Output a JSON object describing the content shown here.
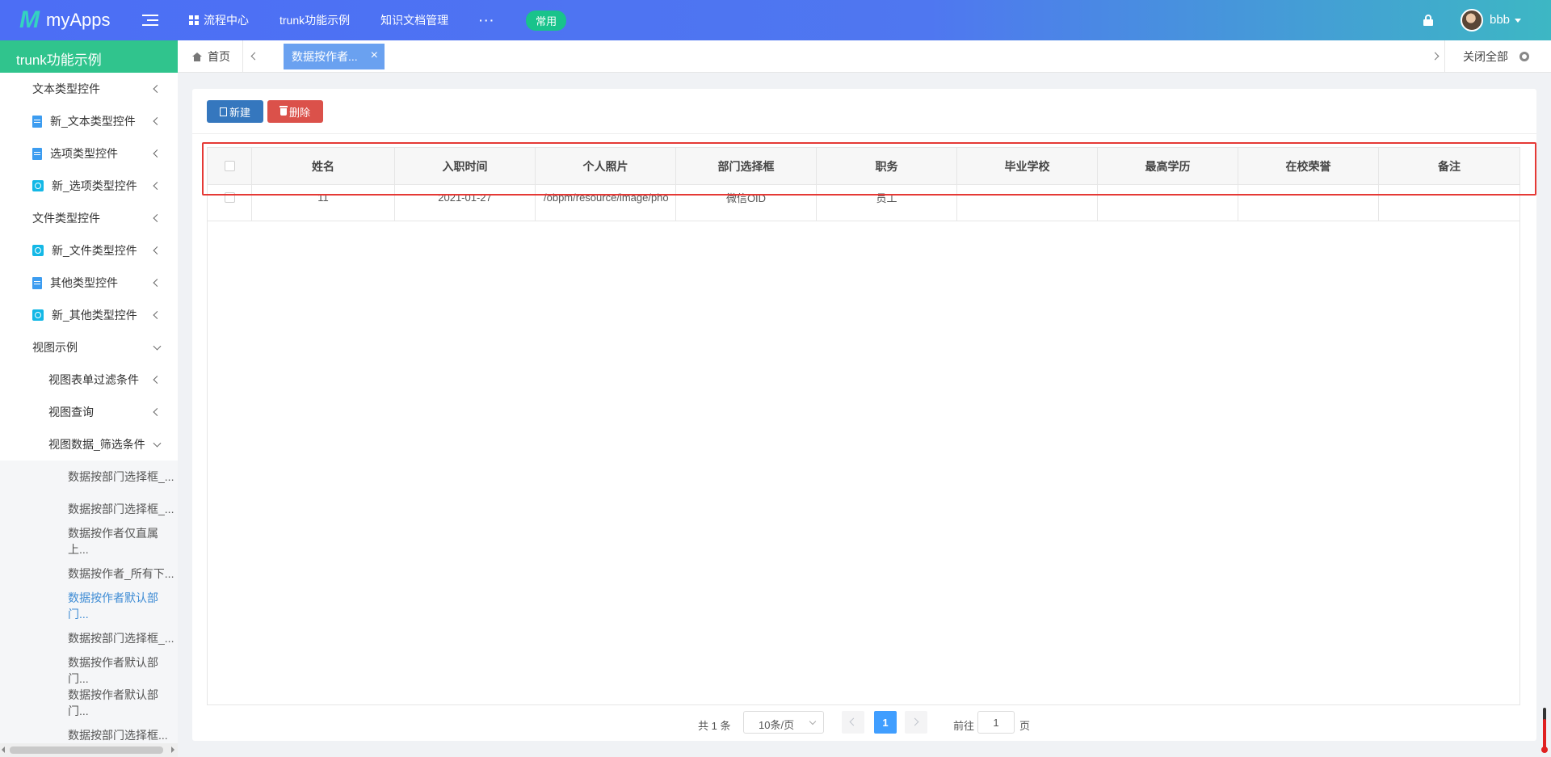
{
  "header": {
    "app_name": "myApps",
    "nav": [
      {
        "label": "流程中心"
      },
      {
        "label": "trunk功能示例"
      },
      {
        "label": "知识文档管理"
      },
      {
        "label": "···"
      }
    ],
    "pill_label": "常用",
    "username": "bbb"
  },
  "sidebar": {
    "title": "trunk功能示例",
    "items": [
      {
        "label": "文本类型控件",
        "icon": "none",
        "chevron": "left"
      },
      {
        "label": "新_文本类型控件",
        "icon": "document-icon",
        "chevron": "left"
      },
      {
        "label": "选项类型控件",
        "icon": "document-icon",
        "chevron": "left"
      },
      {
        "label": "新_选项类型控件",
        "icon": "form-icon",
        "chevron": "left"
      },
      {
        "label": "文件类型控件",
        "icon": "none",
        "chevron": "left"
      },
      {
        "label": "新_文件类型控件",
        "icon": "form-icon",
        "chevron": "left"
      },
      {
        "label": "其他类型控件",
        "icon": "document-icon",
        "chevron": "left"
      },
      {
        "label": "新_其他类型控件",
        "icon": "form-icon",
        "chevron": "left"
      },
      {
        "label": "视图示例",
        "icon": "none",
        "chevron": "down"
      },
      {
        "label": "视图表单过滤条件",
        "icon": "none",
        "chevron": "left"
      },
      {
        "label": "视图查询",
        "icon": "none",
        "chevron": "left"
      },
      {
        "label": "视图数据_筛选条件",
        "icon": "none",
        "chevron": "down"
      },
      {
        "label": "数据按部门选择框_..."
      },
      {
        "label": "数据按部门选择框_..."
      },
      {
        "label": "数据按作者仅直属上..."
      },
      {
        "label": "数据按作者_所有下..."
      },
      {
        "label": "数据按作者默认部门..."
      },
      {
        "label": "数据按部门选择框_..."
      },
      {
        "label": "数据按作者默认部门..."
      },
      {
        "label": "数据按作者默认部门..."
      },
      {
        "label": "数据按部门选择框..."
      }
    ]
  },
  "tabs": {
    "home_label": "首页",
    "active_label": "数据按作者...",
    "close_glyph": "×",
    "close_all_label": "关闭全部"
  },
  "toolbar": {
    "new_label": "新建",
    "delete_label": "删除"
  },
  "table": {
    "columns": [
      "姓名",
      "入职时间",
      "个人照片",
      "部门选择框",
      "职务",
      "毕业学校",
      "最高学历",
      "在校荣誉",
      "备注"
    ],
    "rows": [
      [
        "11",
        "2021-01-27",
        "/obpm/resource/image/pho",
        "微信OID",
        "员工",
        "",
        "",
        "",
        ""
      ]
    ]
  },
  "pagination": {
    "total_text": "共 1 条",
    "page_size": "10条/页",
    "current_page": "1",
    "goto_label": "前往",
    "goto_value": "1",
    "page_suffix": "页"
  },
  "colors": {
    "topbar_start": "#4c6ef5",
    "topbar_end": "#3db7c4",
    "sidebar_head": "#30c48d",
    "active_tab": "#6aa1f0",
    "btn_new": "#3577be",
    "btn_delete": "#db514a",
    "highlight_box": "#e53935",
    "pager_active": "#409eff",
    "pill": "#19c38b"
  }
}
